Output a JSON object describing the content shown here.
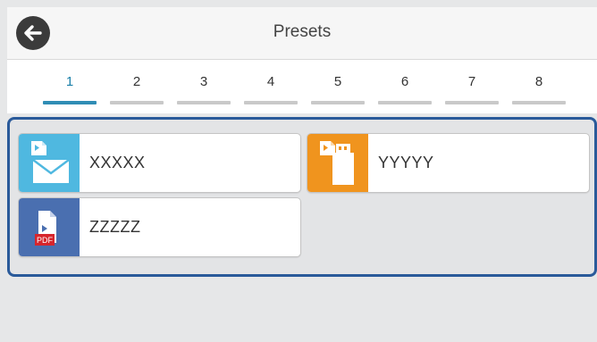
{
  "header": {
    "title": "Presets",
    "back_icon": "arrow-left-icon"
  },
  "tabs": [
    {
      "label": "1",
      "active": true
    },
    {
      "label": "2",
      "active": false
    },
    {
      "label": "3",
      "active": false
    },
    {
      "label": "4",
      "active": false
    },
    {
      "label": "5",
      "active": false
    },
    {
      "label": "6",
      "active": false
    },
    {
      "label": "7",
      "active": false
    },
    {
      "label": "8",
      "active": false
    }
  ],
  "presets": [
    {
      "label": "XXXXX",
      "icon": "scan-to-email-icon",
      "color": "#4fb8e0"
    },
    {
      "label": "YYYYY",
      "icon": "scan-to-memory-device-icon",
      "color": "#f0941e"
    },
    {
      "label": "ZZZZZ",
      "icon": "scan-to-pdf-icon",
      "color": "#4a6fb0",
      "badge": "PDF"
    }
  ],
  "colors": {
    "accent": "#2f8db5",
    "panel_border": "#2a5a9a",
    "pdf_badge": "#d7252c"
  }
}
